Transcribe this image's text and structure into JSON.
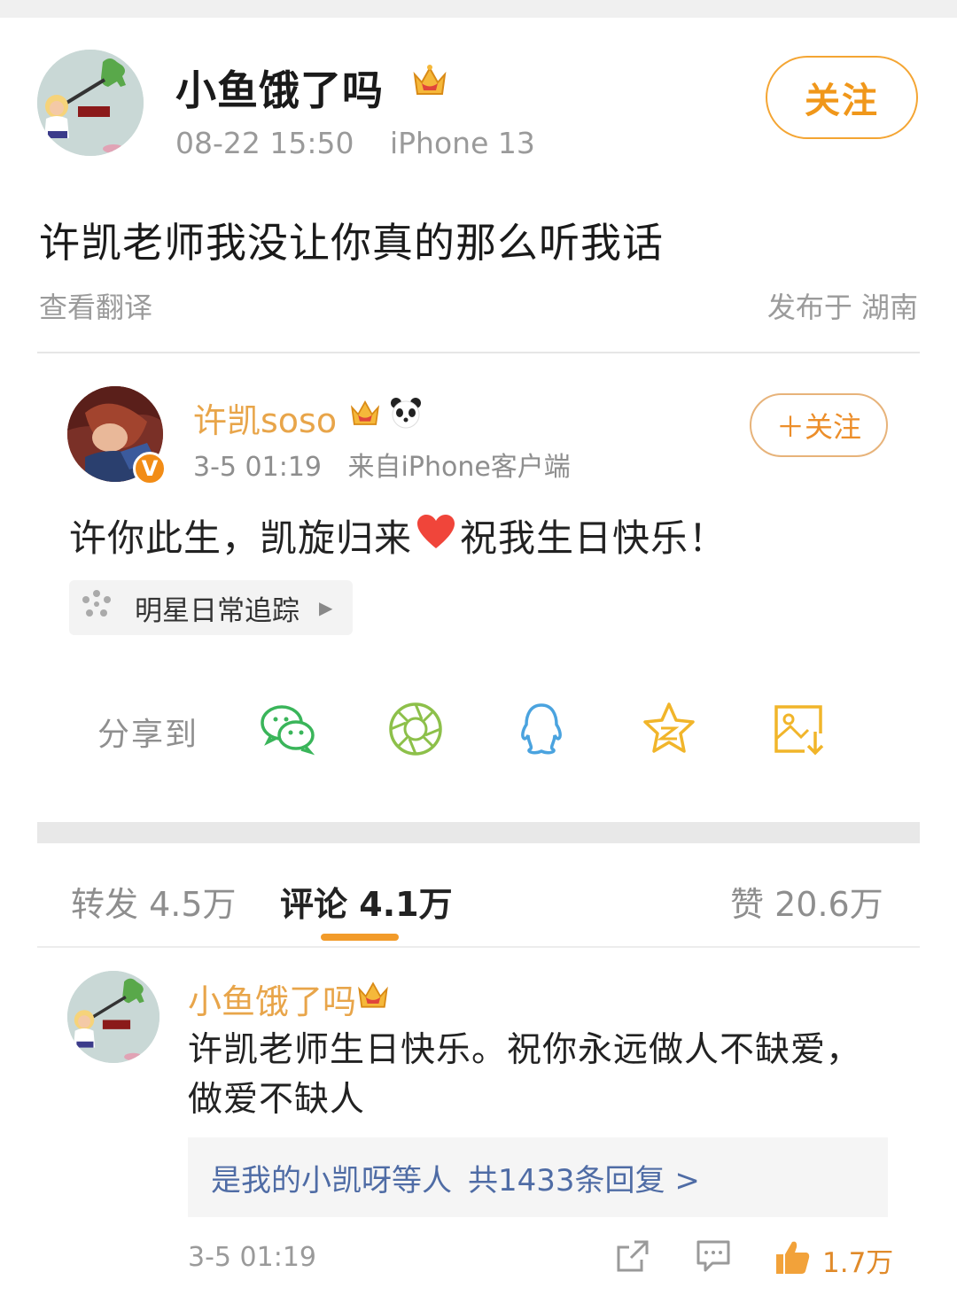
{
  "post": {
    "author": "小鱼饿了吗",
    "time": "08-22 15:50",
    "device": "iPhone 13",
    "follow_label": "关注",
    "text": "许凯老师我没让你真的那么听我话",
    "translate_label": "查看翻译",
    "location": "发布于 湖南"
  },
  "quoted": {
    "author": "许凯soso",
    "time": "3-5 01:19",
    "source": "来自iPhone客户端",
    "follow_label": "＋关注",
    "text_before": "许你此生，凯旋归来",
    "text_after": "祝我生日快乐！",
    "topic": "明星日常追踪",
    "verified_mark": "V"
  },
  "share": {
    "label": "分享到",
    "targets": [
      "wechat-icon",
      "moments-icon",
      "qq-icon",
      "qzone-icon",
      "save-image-icon"
    ]
  },
  "stats": {
    "repost_label": "转发",
    "repost_count": "4.5万",
    "comment_label": "评论",
    "comment_count": "4.1万",
    "like_label": "赞",
    "like_count": "20.6万"
  },
  "comment": {
    "author": "小鱼饿了吗",
    "text": "许凯老师生日快乐。祝你永远做人不缺爱，做爱不缺人",
    "replies_who": "是我的小凯呀等人",
    "replies_count": "共1433条回复 >",
    "time": "3-5 01:19",
    "like_count": "1.7万"
  },
  "colors": {
    "accent": "#f0971a",
    "name_gold": "#e8a54a",
    "link_blue": "#4f6ca5"
  }
}
